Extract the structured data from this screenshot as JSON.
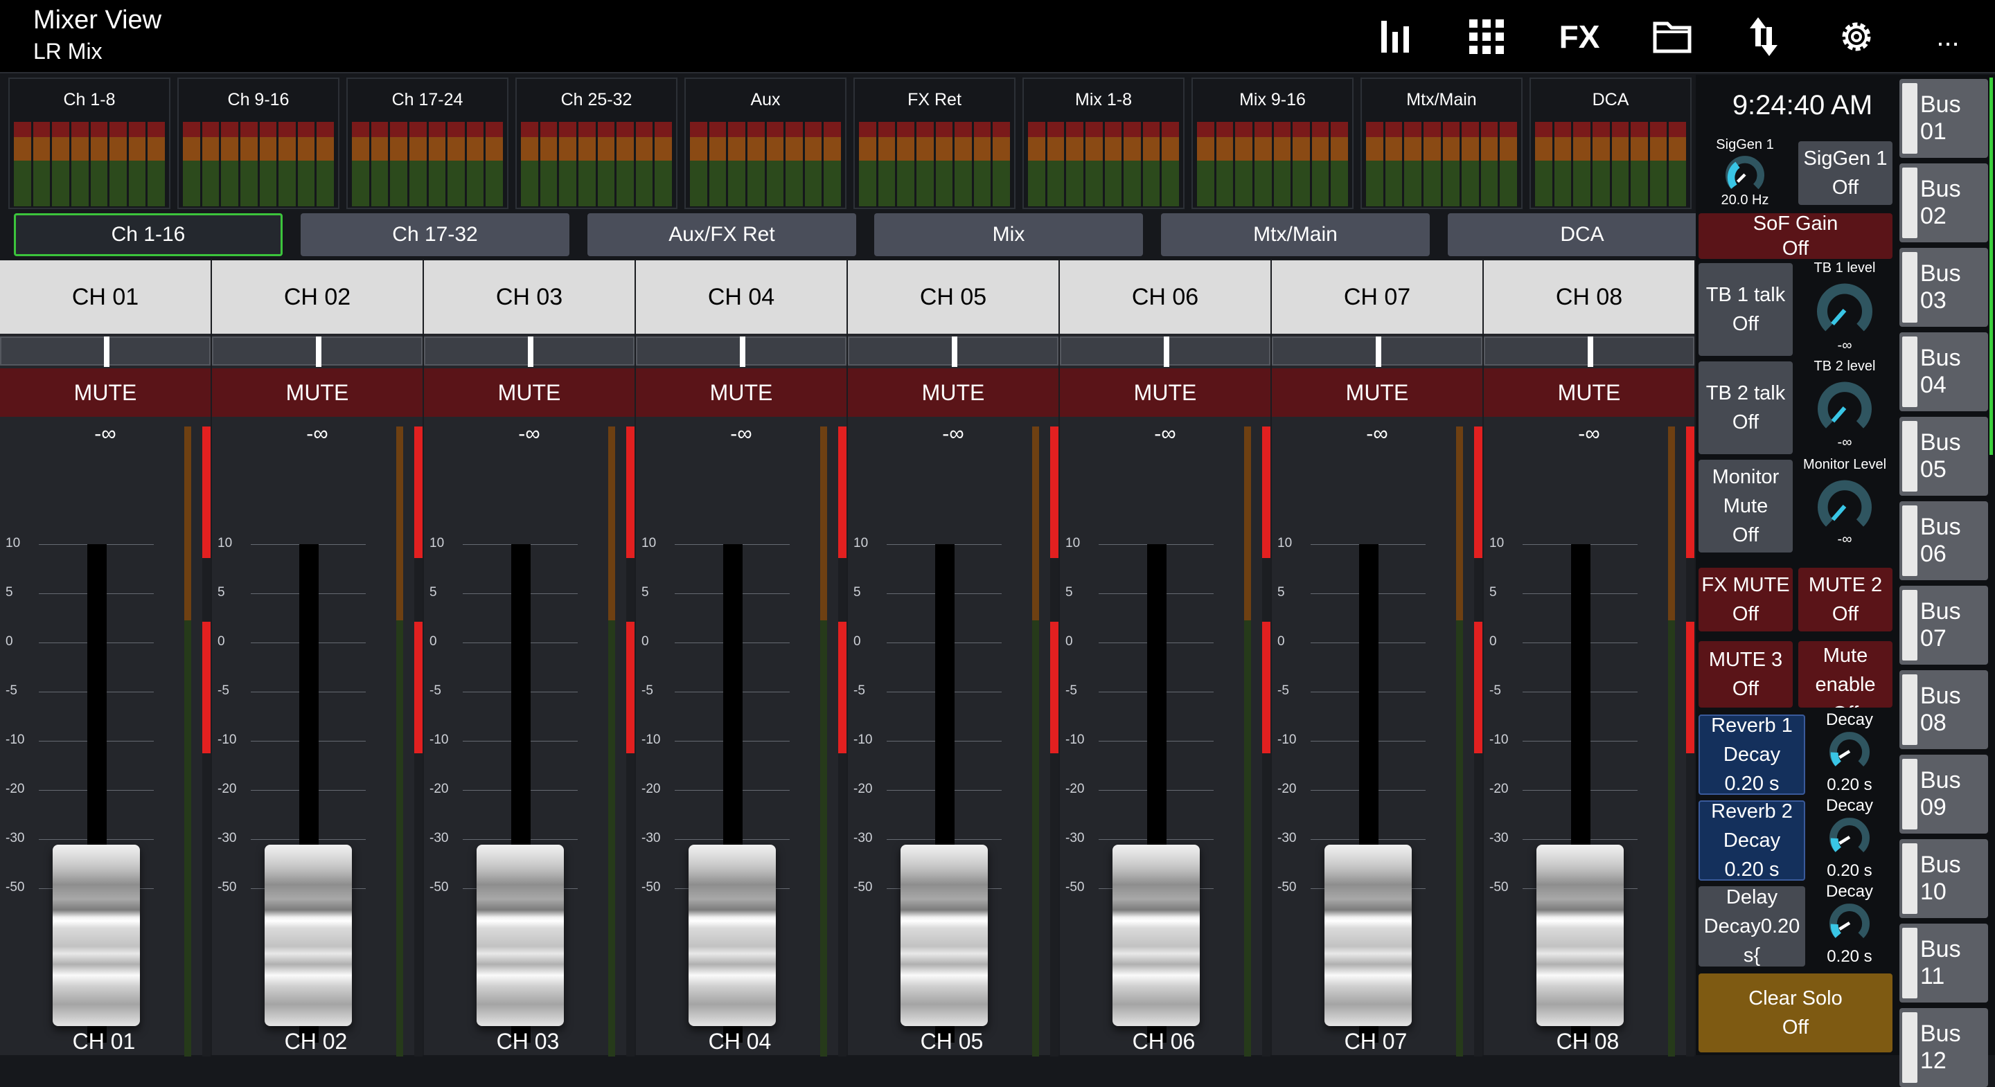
{
  "header": {
    "title": "Mixer View",
    "subtitle": "LR Mix"
  },
  "toolbar": {
    "fx_label": "FX",
    "more_label": "..."
  },
  "groups": [
    "Ch 1-8",
    "Ch 9-16",
    "Ch 17-24",
    "Ch 25-32",
    "Aux",
    "FX Ret",
    "Mix 1-8",
    "Mix 9-16",
    "Mtx/Main",
    "DCA"
  ],
  "tabs": [
    "Ch 1-16",
    "Ch 17-32",
    "Aux/FX Ret",
    "Mix",
    "Mtx/Main",
    "DCA"
  ],
  "active_tab": "Ch 1-16",
  "channels": [
    {
      "name": "CH 01",
      "mute": "MUTE",
      "level": "-∞",
      "foot": "CH 01"
    },
    {
      "name": "CH 02",
      "mute": "MUTE",
      "level": "-∞",
      "foot": "CH 02"
    },
    {
      "name": "CH 03",
      "mute": "MUTE",
      "level": "-∞",
      "foot": "CH 03"
    },
    {
      "name": "CH 04",
      "mute": "MUTE",
      "level": "-∞",
      "foot": "CH 04"
    },
    {
      "name": "CH 05",
      "mute": "MUTE",
      "level": "-∞",
      "foot": "CH 05"
    },
    {
      "name": "CH 06",
      "mute": "MUTE",
      "level": "-∞",
      "foot": "CH 06"
    },
    {
      "name": "CH 07",
      "mute": "MUTE",
      "level": "-∞",
      "foot": "CH 07"
    },
    {
      "name": "CH 08",
      "mute": "MUTE",
      "level": "-∞",
      "foot": "CH 08"
    }
  ],
  "fader_scale": [
    "10",
    "5",
    "0",
    "-5",
    "-10",
    "-20",
    "-30",
    "-50"
  ],
  "right_panel": {
    "clock": "9:24:40 AM",
    "siggen_label": "SigGen 1",
    "siggen_value": "20.0 Hz",
    "siggen_btn": [
      "SigGen 1",
      "Off"
    ],
    "sof_gain": [
      "SoF Gain",
      "Off"
    ],
    "tb1_talk": [
      "TB 1 talk",
      "Off"
    ],
    "tb1_level_label": "TB 1 level",
    "tb1_level_value": "-∞",
    "tb2_talk": [
      "TB 2 talk",
      "Off"
    ],
    "tb2_level_label": "TB 2 level",
    "tb2_level_value": "-∞",
    "monitor_mute": [
      "Monitor",
      "Mute",
      "Off"
    ],
    "monitor_level_label": "Monitor Level",
    "monitor_level_value": "-∞",
    "fx_mute": [
      "FX MUTE",
      "Off"
    ],
    "mute2": [
      "MUTE 2",
      "Off"
    ],
    "mute3": [
      "MUTE 3",
      "Off"
    ],
    "mute_enable": [
      "Mute",
      "enable",
      "Off"
    ],
    "reverb1": [
      "Reverb 1",
      "Decay",
      "0.20 s"
    ],
    "reverb2": [
      "Reverb 2",
      "Decay",
      "0.20 s"
    ],
    "delay": [
      "Delay",
      "Decay0.20",
      "s{"
    ],
    "decay_knobs": [
      {
        "label": "Decay",
        "value": "0.20 s"
      },
      {
        "label": "Decay",
        "value": "0.20 s"
      },
      {
        "label": "Decay",
        "value": "0.20 s"
      }
    ],
    "clear_solo": [
      "Clear Solo",
      "Off"
    ]
  },
  "buses": [
    "Bus 01",
    "Bus 02",
    "Bus 03",
    "Bus 04",
    "Bus 05",
    "Bus 06",
    "Bus 07",
    "Bus 08",
    "Bus 09",
    "Bus 10",
    "Bus 11",
    "Bus 12"
  ],
  "colors": {
    "accent_green": "#3cc43c",
    "mute_red": "#5a1418",
    "knob_cyan": "#39c6e6",
    "solo_gold": "#7e5a12",
    "reverb_blue": "#14305c"
  }
}
